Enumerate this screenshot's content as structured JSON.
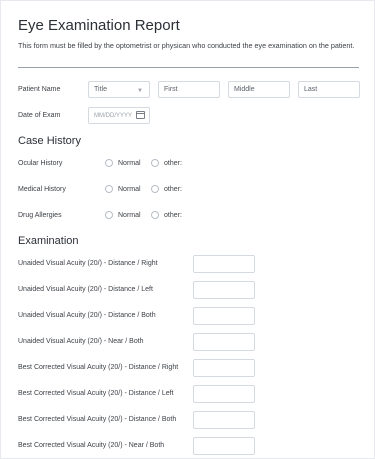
{
  "form": {
    "title": "Eye Examination Report",
    "description": "This form must be filled by the optometrist or physican who conducted the eye examination on the patient."
  },
  "patient_name": {
    "label": "Patient Name",
    "title_select": "Title",
    "first_placeholder": "First",
    "middle_placeholder": "Middle",
    "last_placeholder": "Last"
  },
  "date_of_exam": {
    "label": "Date of Exam",
    "placeholder": "MM/DD/YYYY"
  },
  "case_history": {
    "heading": "Case History",
    "rows": [
      {
        "label": "Ocular History",
        "opt1": "Normal",
        "opt2": "other:"
      },
      {
        "label": "Medical History",
        "opt1": "Normal",
        "opt2": "other:"
      },
      {
        "label": "Drug Allergies",
        "opt1": "Normal",
        "opt2": "other:"
      }
    ]
  },
  "examination": {
    "heading": "Examination",
    "rows": [
      "Unaided Visual Acuity (20/) - Distance / Right",
      "Unaided Visual Acuity (20/) - Distance / Left",
      "Unaided Visual Acuity (20/) - Distance / Both",
      "Unaided Visual Acuity (20/) - Near / Both",
      "Best Corrected Visual Acuity (20/) - Distance / Right",
      "Best Corrected Visual Acuity (20/) - Distance / Left",
      "Best Corrected Visual Acuity (20/) - Distance / Both",
      "Best Corrected Visual Acuity (20/) - Near / Both"
    ]
  },
  "icons": {
    "select": "chevron-down-icon",
    "date": "calendar-icon"
  }
}
